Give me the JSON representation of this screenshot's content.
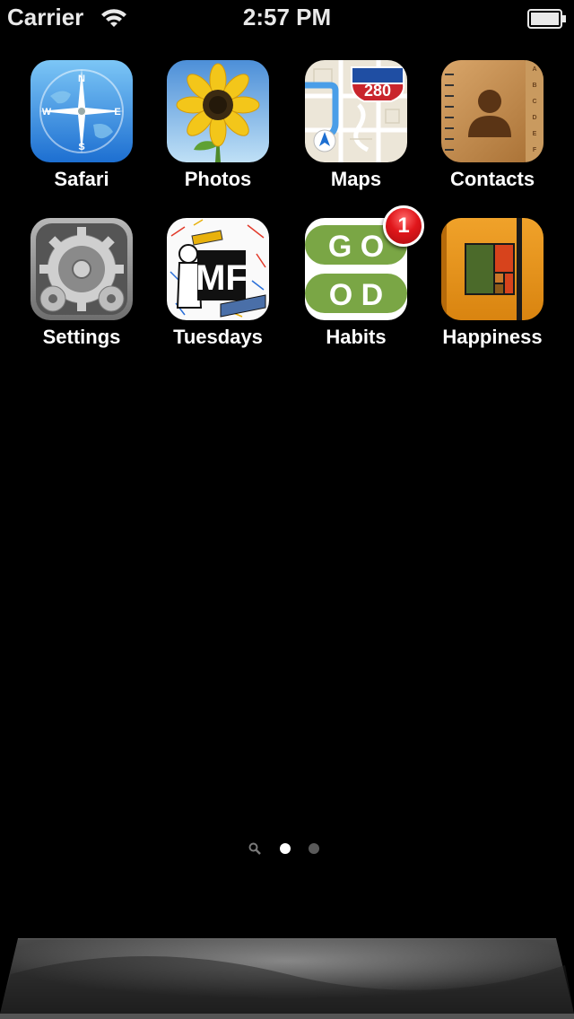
{
  "status_bar": {
    "carrier": "Carrier",
    "time": "2:57 PM",
    "wifi_icon": "wifi-icon",
    "battery_icon": "battery-icon"
  },
  "apps": [
    {
      "label": "Safari",
      "icon": "safari-compass-icon"
    },
    {
      "label": "Photos",
      "icon": "sunflower-icon"
    },
    {
      "label": "Maps",
      "icon": "map-icon",
      "route_sign": "280"
    },
    {
      "label": "Contacts",
      "icon": "address-book-icon",
      "tabs": [
        "A",
        "B",
        "C",
        "D",
        "E",
        "F"
      ]
    },
    {
      "label": "Settings",
      "icon": "gears-icon"
    },
    {
      "label": "Tuesdays",
      "icon": "mf-doodle-icon",
      "icon_text": "MF"
    },
    {
      "label": "Habits",
      "icon": "good-icon",
      "icon_text_top": "G O",
      "icon_text_bottom": "O D",
      "badge": "1"
    },
    {
      "label": "Happiness",
      "icon": "notebook-icon"
    }
  ],
  "page_indicator": {
    "search_icon": "search-icon",
    "pages": 2,
    "current_page": 1
  },
  "colors": {
    "background": "#000000",
    "label_text": "#ffffff",
    "badge_red": "#e0161b",
    "habits_green": "#7aa645",
    "happiness_orange": "#e8961e"
  }
}
